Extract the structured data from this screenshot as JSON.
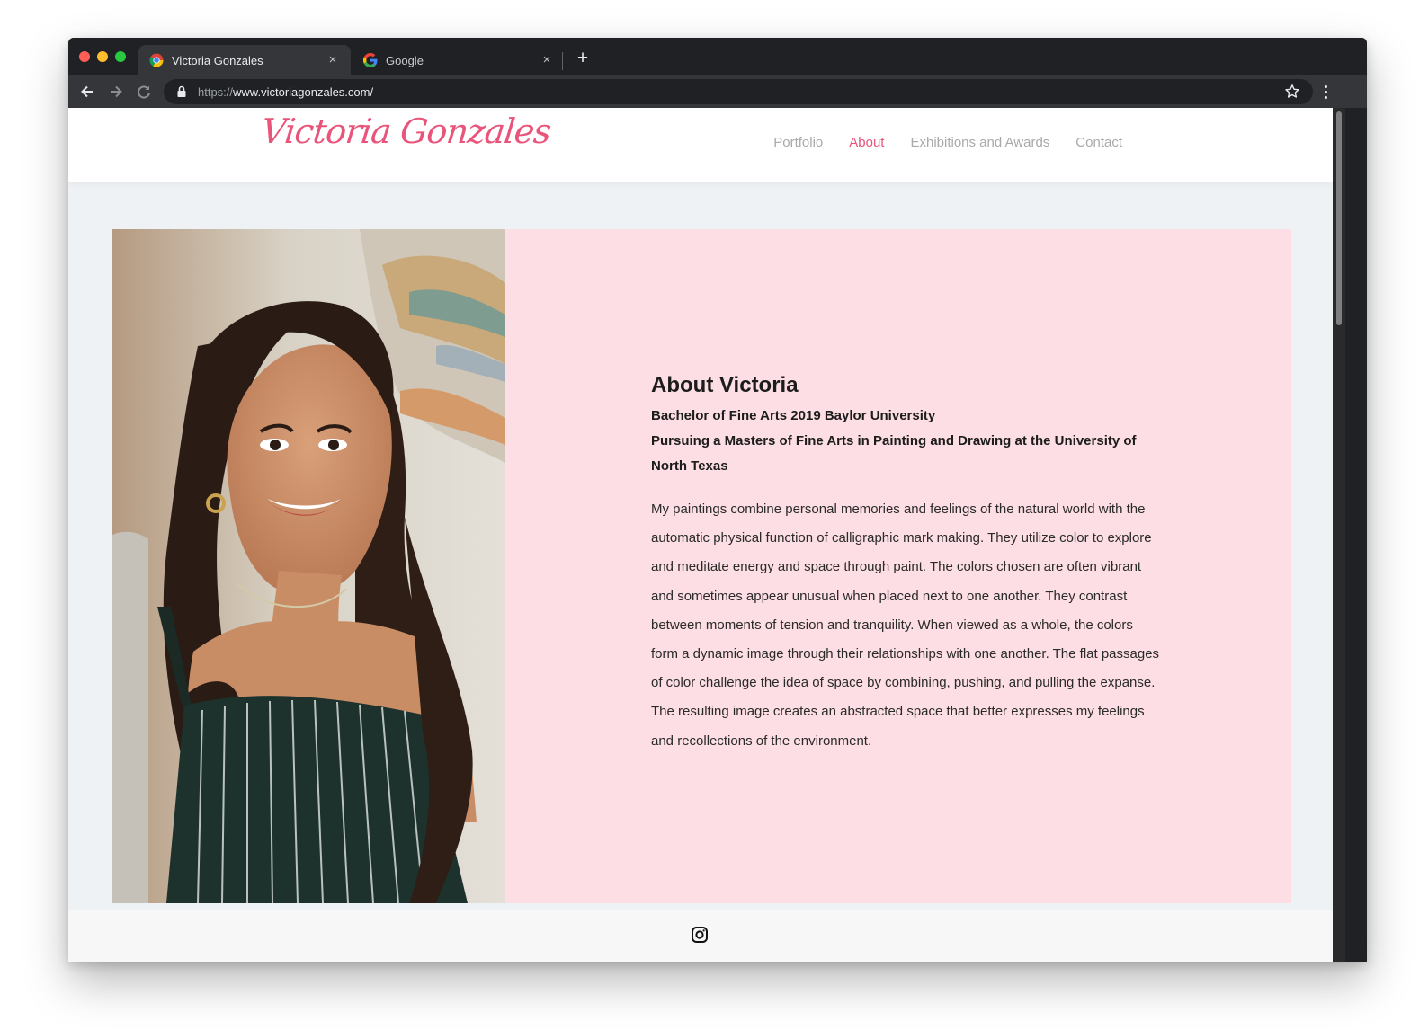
{
  "browser": {
    "tabs": [
      {
        "title": "Victoria Gonzales",
        "active": true
      },
      {
        "title": "Google",
        "active": false
      }
    ],
    "close_glyph": "×",
    "new_tab_glyph": "+",
    "url_scheme": "https://",
    "url_rest": "www.victoriagonzales.com/"
  },
  "site": {
    "logo": "Victoria Gonzales",
    "nav": [
      {
        "label": "Portfolio"
      },
      {
        "label": "About"
      },
      {
        "label": "Exhibitions and Awards"
      },
      {
        "label": "Contact"
      }
    ],
    "accent": "#e9547a"
  },
  "about": {
    "title": "About Victoria",
    "degree": "Bachelor of Fine Arts 2019 Baylor University",
    "pursuing": "Pursuing a Masters of Fine Arts in Painting and Drawing at the University of North Texas",
    "body": "My paintings combine personal memories and feelings of the natural world with the automatic physical function of calligraphic mark making. They utilize color to explore and meditate energy and space through paint. The colors chosen are often vibrant and sometimes appear unusual when placed next to one another. They contrast between moments of tension and tranquility. When viewed as a whole, the colors form a dynamic image through their relationships with one another. The flat passages of color challenge the idea of space by combining, pushing, and pulling the expanse. The resulting image creates an abstracted space that better expresses my feelings and recollections of the environment."
  },
  "footer": {
    "social": "instagram-icon"
  }
}
